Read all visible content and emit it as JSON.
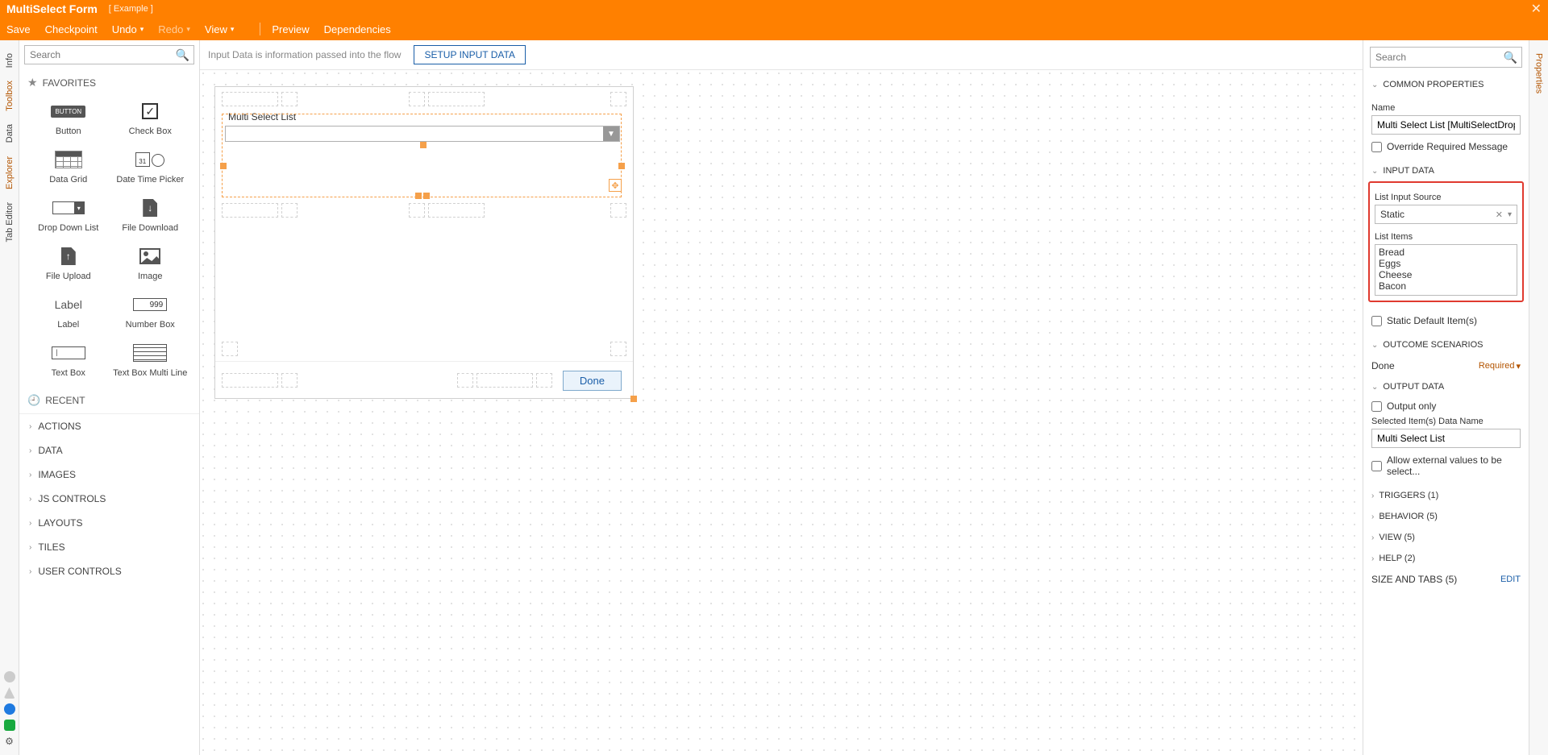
{
  "header": {
    "title": "MultiSelect Form",
    "subtitle": "[ Example ]",
    "close": "✕"
  },
  "menu": {
    "save": "Save",
    "checkpoint": "Checkpoint",
    "undo": "Undo",
    "redo": "Redo",
    "view": "View",
    "preview": "Preview",
    "dependencies": "Dependencies"
  },
  "leftrail": {
    "info": "Info",
    "toolbox": "Toolbox",
    "data": "Data",
    "explorer": "Explorer",
    "tabeditor": "Tab Editor"
  },
  "rightrail": {
    "properties": "Properties"
  },
  "toolbox": {
    "search_placeholder": "Search",
    "favorites_header": "FAVORITES",
    "items": {
      "button": "Button",
      "checkbox": "Check Box",
      "datagrid": "Data Grid",
      "datetime": "Date Time Picker",
      "dropdown": "Drop Down List",
      "filedl": "File Download",
      "fileup": "File Upload",
      "image": "Image",
      "label": "Label",
      "numbox": "Number Box",
      "textbox": "Text Box",
      "textboxml": "Text Box Multi Line"
    },
    "numbox_sample": "999",
    "label_sample": "Label",
    "button_sample": "BUTTON",
    "recent_header": "RECENT",
    "cats": {
      "actions": "ACTIONS",
      "data": "DATA",
      "images": "IMAGES",
      "js": "JS CONTROLS",
      "layouts": "LAYOUTS",
      "tiles": "TILES",
      "user": "USER CONTROLS"
    }
  },
  "canvas": {
    "hint": "Input Data is information passed into the flow",
    "setup_btn": "SETUP INPUT DATA",
    "ms_label": "Multi Select List",
    "done": "Done"
  },
  "props": {
    "search_placeholder": "Search",
    "common_h": "COMMON PROPERTIES",
    "name_lbl": "Name",
    "name_val": "Multi Select List [MultiSelectDropDown]",
    "override": "Override Required Message",
    "input_h": "INPUT DATA",
    "lis_lbl": "List Input Source",
    "lis_val": "Static",
    "li_lbl": "List Items",
    "li_items": [
      "Bread",
      "Eggs",
      "Cheese",
      "Bacon"
    ],
    "static_def": "Static Default Item(s)",
    "outcome_h": "OUTCOME SCENARIOS",
    "outcome_done": "Done",
    "outcome_req": "Required",
    "output_h": "OUTPUT DATA",
    "output_only": "Output only",
    "sel_name_lbl": "Selected Item(s) Data Name",
    "sel_name_val": "Multi Select List",
    "allow_ext": "Allow external values to be select...",
    "triggers": "TRIGGERS (1)",
    "behavior": "BEHAVIOR (5)",
    "view": "VIEW (5)",
    "help": "HELP (2)",
    "size_tabs": "SIZE AND TABS (5)",
    "edit": "EDIT"
  }
}
